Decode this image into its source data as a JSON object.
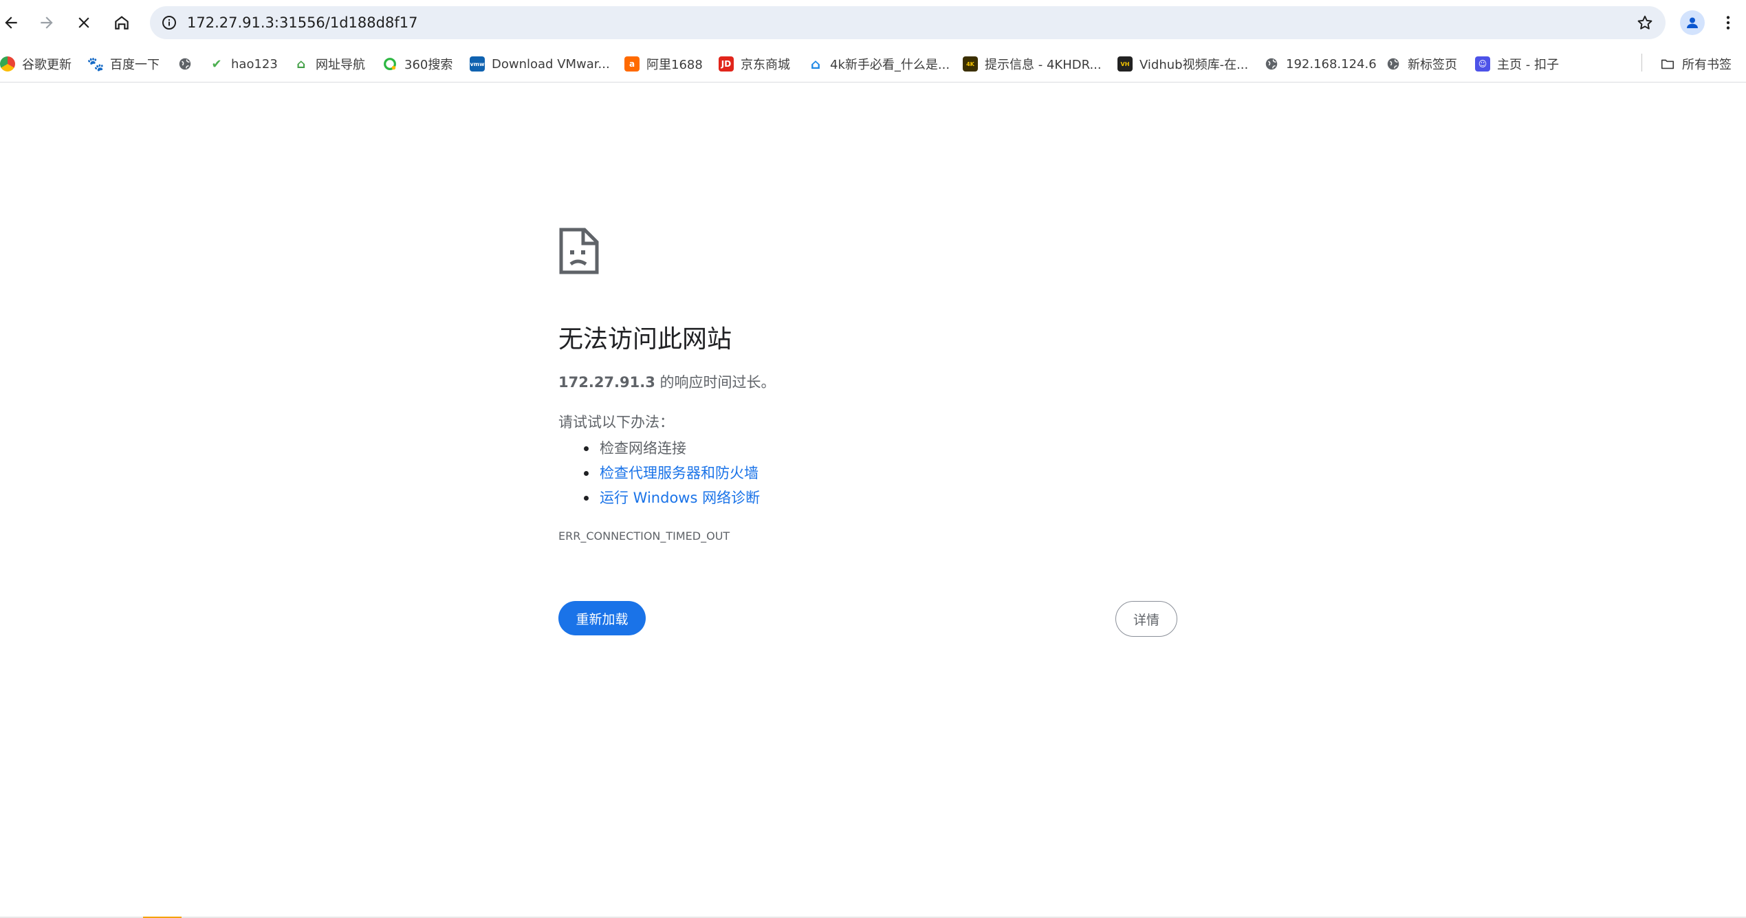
{
  "toolbar": {
    "back_icon": "arrow-left-icon",
    "forward_icon": "arrow-right-icon",
    "stop_icon": "close-icon",
    "home_icon": "home-icon",
    "url": "172.27.91.3:31556/1d188d8f17"
  },
  "bookmarks": [
    {
      "label": "谷歌更新",
      "icon": "chrome-icon",
      "color": "#4285f4"
    },
    {
      "label": "百度一下",
      "icon": "baidu-paw-icon",
      "color": "#2932e1"
    },
    {
      "label": "",
      "icon": "globe-icon",
      "color": "#5f6368"
    },
    {
      "label": "hao123",
      "icon": "hao123-icon",
      "color": "#4caf50"
    },
    {
      "label": "网址导航",
      "icon": "navigation-icon",
      "color": "#43a047"
    },
    {
      "label": "360搜索",
      "icon": "360-search-icon",
      "color": "#2cb742"
    },
    {
      "label": "Download VMwar...",
      "icon": "vmware-icon",
      "color": "#0f62b0"
    },
    {
      "label": "阿里1688",
      "icon": "alibaba-1688-icon",
      "color": "#ff6a00"
    },
    {
      "label": "京东商城",
      "icon": "jd-icon",
      "color": "#e1251b"
    },
    {
      "label": "4k新手必看_什么是...",
      "icon": "house-icon",
      "color": "#1e88e5"
    },
    {
      "label": "提示信息 - 4KHDR...",
      "icon": "4khdr-icon",
      "color": "#c8a000"
    },
    {
      "label": "Vidhub视频库-在...",
      "icon": "vidhub-icon",
      "color": "#222222"
    },
    {
      "label": "192.168.124.6",
      "icon": "globe-icon",
      "color": "#5f6368"
    },
    {
      "label": "新标签页",
      "icon": "globe-icon",
      "color": "#5f6368"
    },
    {
      "label": "主页 - 扣子",
      "icon": "coze-icon",
      "color": "#4d53e8"
    }
  ],
  "all_bookmarks_label": "所有书签",
  "error": {
    "title": "无法访问此网站",
    "host": "172.27.91.3",
    "desc_suffix": " 的响应时间过长。",
    "try_label": "请试试以下办法：",
    "suggestions": [
      {
        "text": "检查网络连接",
        "link": false
      },
      {
        "text": "检查代理服务器和防火墙",
        "link": true
      },
      {
        "text": "运行 Windows 网络诊断",
        "link": true
      }
    ],
    "code": "ERR_CONNECTION_TIMED_OUT",
    "reload_label": "重新加载",
    "details_label": "详情"
  },
  "colors": {
    "accent": "#1a73e8",
    "omnibox_bg": "#e9eef6",
    "secondary_text": "#5f6368"
  }
}
